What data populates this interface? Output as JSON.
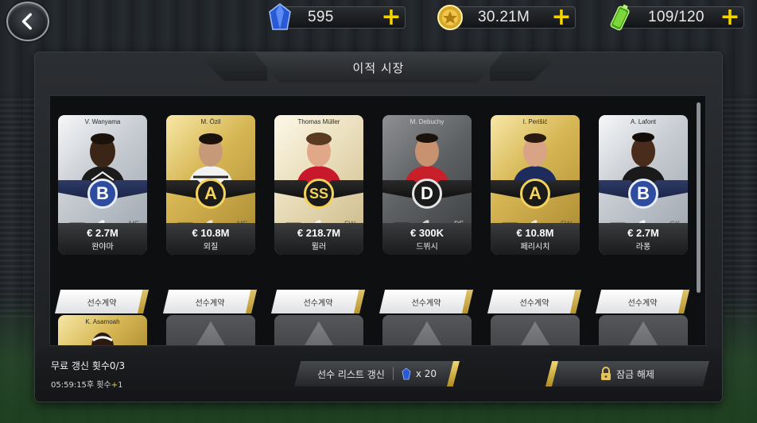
{
  "header": {
    "currencies": [
      {
        "icon": "blue-gem-icon",
        "value": "595"
      },
      {
        "icon": "gold-coin-icon",
        "value": "30.21M"
      },
      {
        "icon": "energy-battery-icon",
        "value": "109/120"
      }
    ]
  },
  "title": "이적 시장",
  "players": [
    {
      "card_name": "V. Wanyama",
      "grade": "B",
      "level": "1",
      "position": "MF",
      "price": "€ 2.7M",
      "name": "완야마",
      "flag": "kenya"
    },
    {
      "card_name": "M. Özil",
      "grade": "A",
      "level": "1",
      "position": "MF",
      "price": "€ 10.8M",
      "name": "외질",
      "flag": "germany"
    },
    {
      "card_name": "Thomas Müller",
      "grade": "SS",
      "level": "1",
      "position": "FW\nMF",
      "price": "€ 218.7M",
      "name": "뮐러",
      "flag": "germany"
    },
    {
      "card_name": "M. Debuchy",
      "grade": "D",
      "level": "1",
      "position": "DF\nMF",
      "price": "€ 300K",
      "name": "드뷔시",
      "flag": "france"
    },
    {
      "card_name": "I. Perišić",
      "grade": "A",
      "level": "1",
      "position": "FW\nMF",
      "price": "€ 10.8M",
      "name": "페리시치",
      "flag": "croatia"
    },
    {
      "card_name": "A. Lafont",
      "grade": "B",
      "level": "1",
      "position": "GK",
      "price": "€ 2.7M",
      "name": "라퐁",
      "flag": "france"
    }
  ],
  "contract_label": "선수계약",
  "second_row": {
    "partial_card_name": "K. Asamoah"
  },
  "bottom": {
    "free_refresh": "무료 갱신 횟수0/3",
    "timer_text": "05:59:15후 횟수",
    "timer_plus": "+1",
    "refresh_label": "선수 리스트 갱신",
    "refresh_cost": "x 20",
    "unlock_label": "잠금 해제"
  }
}
